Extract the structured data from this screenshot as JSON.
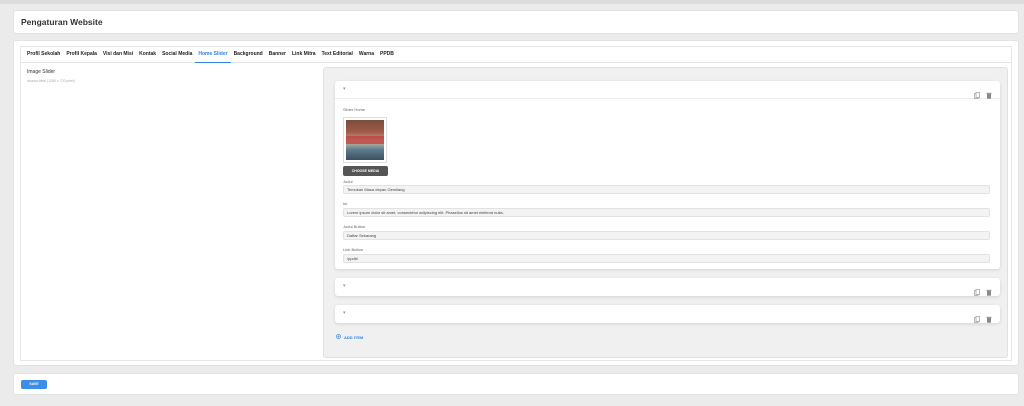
{
  "header": {
    "title": "Pengaturan Website"
  },
  "tabs": [
    {
      "label": "Profil Sekolah",
      "active": false
    },
    {
      "label": "Profil Kepala",
      "active": false
    },
    {
      "label": "Visi dan Misi",
      "active": false
    },
    {
      "label": "Kontak",
      "active": false
    },
    {
      "label": "Social Media",
      "active": false
    },
    {
      "label": "Home Slider",
      "active": true
    },
    {
      "label": "Background",
      "active": false
    },
    {
      "label": "Banner",
      "active": false
    },
    {
      "label": "Link Mitra",
      "active": false
    },
    {
      "label": "Text Editorial",
      "active": false
    },
    {
      "label": "Warna",
      "active": false
    },
    {
      "label": "PPDB",
      "active": false
    }
  ],
  "slider_field": {
    "label": "Image Slider",
    "help": "ukuran ideal (1280 x 720 pixel)"
  },
  "items": [
    {
      "expanded": true,
      "image_label": "Slider Home",
      "choose_media_label": "CHOOSE MEDIA",
      "judul_label": "Judul",
      "judul_value": "Temukan Masa depan Gemilang",
      "isi_label": "Isi",
      "isi_value": "Lorem ipsum dolor sit amet, consectetur adipiscing elit. Phasellus sit amet eleifend nulla.",
      "judul_button_label": "Judul Button",
      "judul_button_value": "Daftar Sekarang",
      "link_button_label": "Link Button",
      "link_button_value": "/ppdb/"
    },
    {
      "expanded": false
    },
    {
      "expanded": false
    }
  ],
  "add_item_label": "ADD ITEM",
  "footer": {
    "save_label": "SAVE"
  },
  "colors": {
    "accent": "#2f83e2",
    "save": "#3b8de6",
    "background": "#ebebeb"
  },
  "icons": {
    "expand": "chevron-down-icon",
    "duplicate": "copy-icon",
    "delete": "trash-icon",
    "add": "plus-circle-icon"
  }
}
